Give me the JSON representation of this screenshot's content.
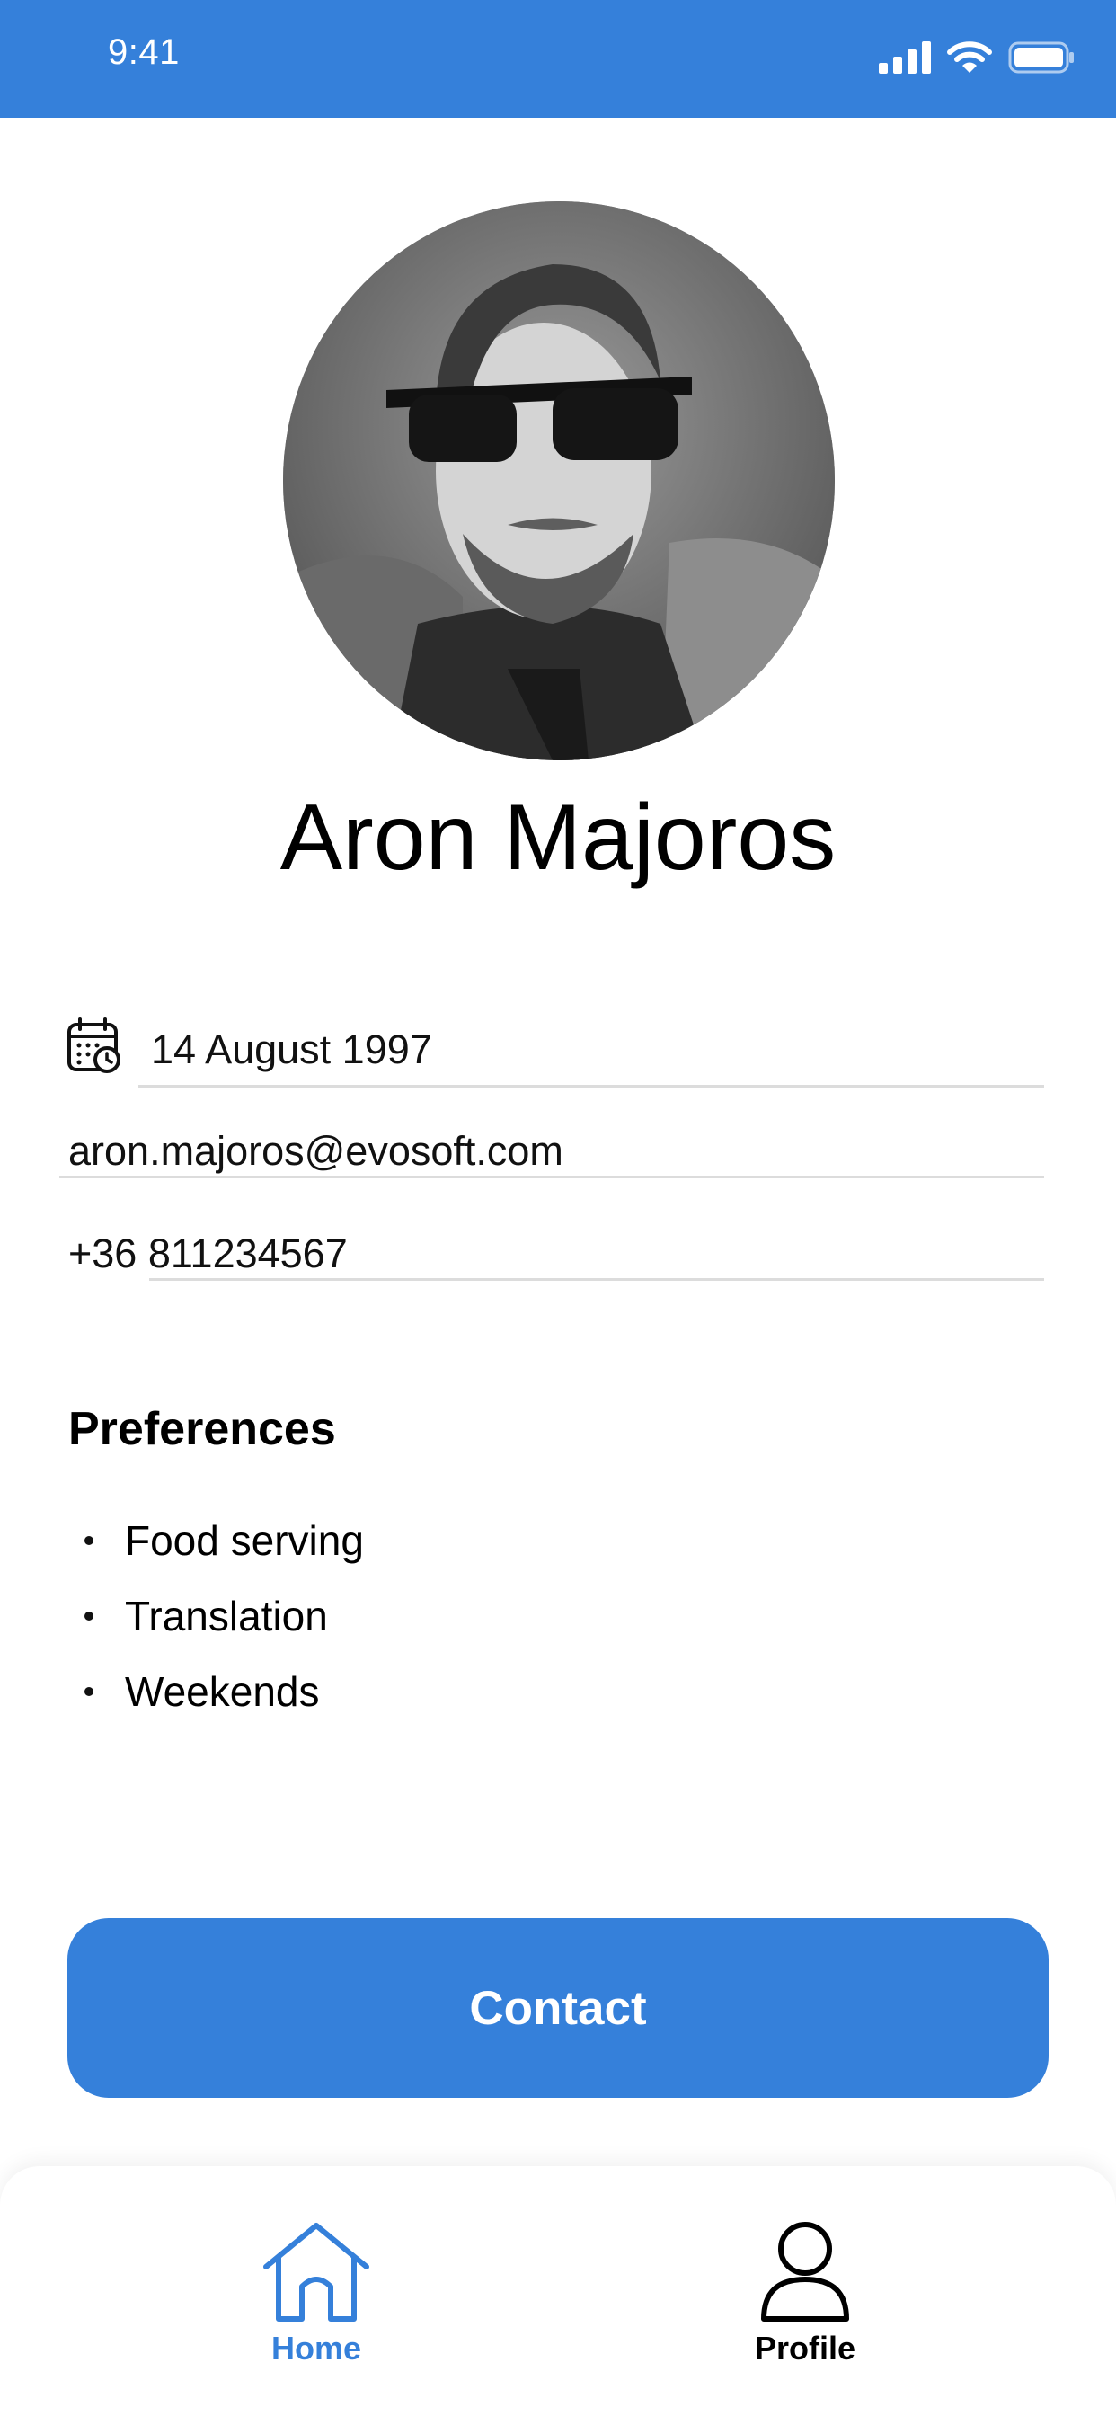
{
  "status_bar": {
    "time": "9:41",
    "signal_icon": "cellular-signal-icon",
    "wifi_icon": "wifi-icon",
    "battery_icon": "battery-icon",
    "background_color": "#3580da"
  },
  "profile": {
    "name": "Aron Majoros",
    "avatar_icon": "profile-photo"
  },
  "details": {
    "birthdate_icon": "calendar-icon",
    "birthdate": "14 August 1997",
    "email": "aron.majoros@evosoft.com",
    "phone": "+36 811234567"
  },
  "preferences": {
    "title": "Preferences",
    "items": [
      "Food serving",
      "Translation",
      "Weekends"
    ]
  },
  "contact_button": {
    "label": "Contact",
    "color": "#3580da"
  },
  "tab_bar": {
    "tabs": [
      {
        "label": "Home",
        "icon": "home-icon",
        "active": true,
        "color": "#3580da"
      },
      {
        "label": "Profile",
        "icon": "person-icon",
        "active": false,
        "color": "#000000"
      }
    ]
  }
}
